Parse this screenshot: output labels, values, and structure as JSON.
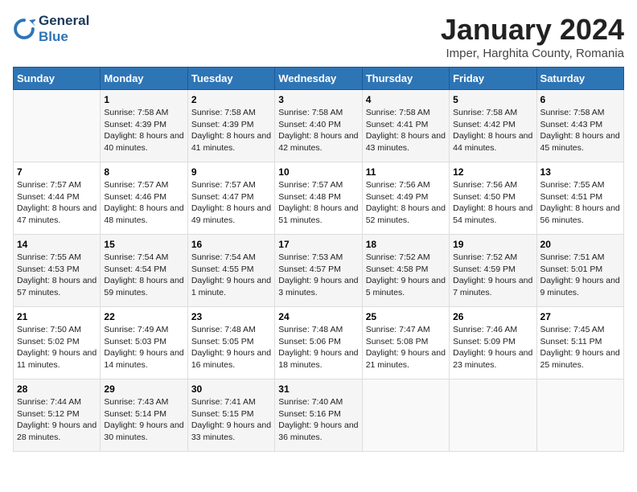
{
  "logo": {
    "line1": "General",
    "line2": "Blue"
  },
  "title": "January 2024",
  "subtitle": "Imper, Harghita County, Romania",
  "days_of_week": [
    "Sunday",
    "Monday",
    "Tuesday",
    "Wednesday",
    "Thursday",
    "Friday",
    "Saturday"
  ],
  "weeks": [
    [
      {
        "day": "",
        "sunrise": "",
        "sunset": "",
        "daylight": ""
      },
      {
        "day": "1",
        "sunrise": "Sunrise: 7:58 AM",
        "sunset": "Sunset: 4:39 PM",
        "daylight": "Daylight: 8 hours and 40 minutes."
      },
      {
        "day": "2",
        "sunrise": "Sunrise: 7:58 AM",
        "sunset": "Sunset: 4:39 PM",
        "daylight": "Daylight: 8 hours and 41 minutes."
      },
      {
        "day": "3",
        "sunrise": "Sunrise: 7:58 AM",
        "sunset": "Sunset: 4:40 PM",
        "daylight": "Daylight: 8 hours and 42 minutes."
      },
      {
        "day": "4",
        "sunrise": "Sunrise: 7:58 AM",
        "sunset": "Sunset: 4:41 PM",
        "daylight": "Daylight: 8 hours and 43 minutes."
      },
      {
        "day": "5",
        "sunrise": "Sunrise: 7:58 AM",
        "sunset": "Sunset: 4:42 PM",
        "daylight": "Daylight: 8 hours and 44 minutes."
      },
      {
        "day": "6",
        "sunrise": "Sunrise: 7:58 AM",
        "sunset": "Sunset: 4:43 PM",
        "daylight": "Daylight: 8 hours and 45 minutes."
      }
    ],
    [
      {
        "day": "7",
        "sunrise": "Sunrise: 7:57 AM",
        "sunset": "Sunset: 4:44 PM",
        "daylight": "Daylight: 8 hours and 47 minutes."
      },
      {
        "day": "8",
        "sunrise": "Sunrise: 7:57 AM",
        "sunset": "Sunset: 4:46 PM",
        "daylight": "Daylight: 8 hours and 48 minutes."
      },
      {
        "day": "9",
        "sunrise": "Sunrise: 7:57 AM",
        "sunset": "Sunset: 4:47 PM",
        "daylight": "Daylight: 8 hours and 49 minutes."
      },
      {
        "day": "10",
        "sunrise": "Sunrise: 7:57 AM",
        "sunset": "Sunset: 4:48 PM",
        "daylight": "Daylight: 8 hours and 51 minutes."
      },
      {
        "day": "11",
        "sunrise": "Sunrise: 7:56 AM",
        "sunset": "Sunset: 4:49 PM",
        "daylight": "Daylight: 8 hours and 52 minutes."
      },
      {
        "day": "12",
        "sunrise": "Sunrise: 7:56 AM",
        "sunset": "Sunset: 4:50 PM",
        "daylight": "Daylight: 8 hours and 54 minutes."
      },
      {
        "day": "13",
        "sunrise": "Sunrise: 7:55 AM",
        "sunset": "Sunset: 4:51 PM",
        "daylight": "Daylight: 8 hours and 56 minutes."
      }
    ],
    [
      {
        "day": "14",
        "sunrise": "Sunrise: 7:55 AM",
        "sunset": "Sunset: 4:53 PM",
        "daylight": "Daylight: 8 hours and 57 minutes."
      },
      {
        "day": "15",
        "sunrise": "Sunrise: 7:54 AM",
        "sunset": "Sunset: 4:54 PM",
        "daylight": "Daylight: 8 hours and 59 minutes."
      },
      {
        "day": "16",
        "sunrise": "Sunrise: 7:54 AM",
        "sunset": "Sunset: 4:55 PM",
        "daylight": "Daylight: 9 hours and 1 minute."
      },
      {
        "day": "17",
        "sunrise": "Sunrise: 7:53 AM",
        "sunset": "Sunset: 4:57 PM",
        "daylight": "Daylight: 9 hours and 3 minutes."
      },
      {
        "day": "18",
        "sunrise": "Sunrise: 7:52 AM",
        "sunset": "Sunset: 4:58 PM",
        "daylight": "Daylight: 9 hours and 5 minutes."
      },
      {
        "day": "19",
        "sunrise": "Sunrise: 7:52 AM",
        "sunset": "Sunset: 4:59 PM",
        "daylight": "Daylight: 9 hours and 7 minutes."
      },
      {
        "day": "20",
        "sunrise": "Sunrise: 7:51 AM",
        "sunset": "Sunset: 5:01 PM",
        "daylight": "Daylight: 9 hours and 9 minutes."
      }
    ],
    [
      {
        "day": "21",
        "sunrise": "Sunrise: 7:50 AM",
        "sunset": "Sunset: 5:02 PM",
        "daylight": "Daylight: 9 hours and 11 minutes."
      },
      {
        "day": "22",
        "sunrise": "Sunrise: 7:49 AM",
        "sunset": "Sunset: 5:03 PM",
        "daylight": "Daylight: 9 hours and 14 minutes."
      },
      {
        "day": "23",
        "sunrise": "Sunrise: 7:48 AM",
        "sunset": "Sunset: 5:05 PM",
        "daylight": "Daylight: 9 hours and 16 minutes."
      },
      {
        "day": "24",
        "sunrise": "Sunrise: 7:48 AM",
        "sunset": "Sunset: 5:06 PM",
        "daylight": "Daylight: 9 hours and 18 minutes."
      },
      {
        "day": "25",
        "sunrise": "Sunrise: 7:47 AM",
        "sunset": "Sunset: 5:08 PM",
        "daylight": "Daylight: 9 hours and 21 minutes."
      },
      {
        "day": "26",
        "sunrise": "Sunrise: 7:46 AM",
        "sunset": "Sunset: 5:09 PM",
        "daylight": "Daylight: 9 hours and 23 minutes."
      },
      {
        "day": "27",
        "sunrise": "Sunrise: 7:45 AM",
        "sunset": "Sunset: 5:11 PM",
        "daylight": "Daylight: 9 hours and 25 minutes."
      }
    ],
    [
      {
        "day": "28",
        "sunrise": "Sunrise: 7:44 AM",
        "sunset": "Sunset: 5:12 PM",
        "daylight": "Daylight: 9 hours and 28 minutes."
      },
      {
        "day": "29",
        "sunrise": "Sunrise: 7:43 AM",
        "sunset": "Sunset: 5:14 PM",
        "daylight": "Daylight: 9 hours and 30 minutes."
      },
      {
        "day": "30",
        "sunrise": "Sunrise: 7:41 AM",
        "sunset": "Sunset: 5:15 PM",
        "daylight": "Daylight: 9 hours and 33 minutes."
      },
      {
        "day": "31",
        "sunrise": "Sunrise: 7:40 AM",
        "sunset": "Sunset: 5:16 PM",
        "daylight": "Daylight: 9 hours and 36 minutes."
      },
      {
        "day": "",
        "sunrise": "",
        "sunset": "",
        "daylight": ""
      },
      {
        "day": "",
        "sunrise": "",
        "sunset": "",
        "daylight": ""
      },
      {
        "day": "",
        "sunrise": "",
        "sunset": "",
        "daylight": ""
      }
    ]
  ]
}
